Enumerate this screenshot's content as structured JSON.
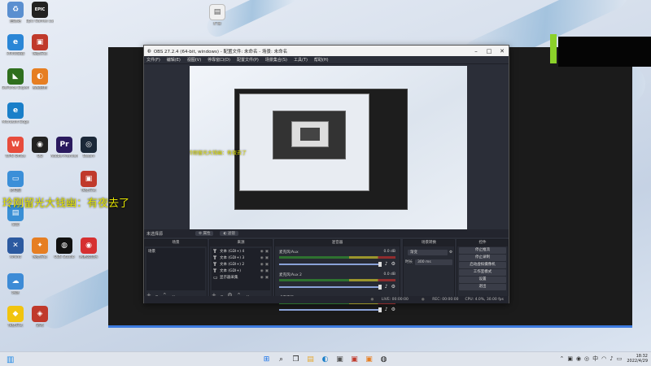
{
  "desktop": {
    "icons": [
      {
        "id": "recycle",
        "label": "回收站",
        "glyph": "♻",
        "color": "#5a8fd0"
      },
      {
        "id": "epic",
        "label": "Epic Games Launcher",
        "glyph": "EPIC",
        "color": "#222222"
      },
      {
        "id": "ie",
        "label": "360浏览器",
        "glyph": "e",
        "color": "#2a86d6"
      },
      {
        "id": "dl",
        "label": "快捷方式",
        "glyph": "▣",
        "color": "#c0392b"
      },
      {
        "id": "geforce",
        "label": "GeForce Experience",
        "glyph": "◣",
        "color": "#2f6f1e"
      },
      {
        "id": "colorapp",
        "label": "系统应用",
        "glyph": "◐",
        "color": "#e67e22"
      },
      {
        "id": "edge",
        "label": "Microsoft Edge",
        "glyph": "e",
        "color": "#1a7fc9"
      },
      {
        "id": "wps",
        "label": "WPS Office",
        "glyph": "W",
        "color": "#e74c3c"
      },
      {
        "id": "qq",
        "label": "QQ",
        "glyph": "◉",
        "color": "#222222"
      },
      {
        "id": "premiere",
        "label": "Adobe Premiere",
        "glyph": "Pr",
        "color": "#2a1a5e"
      },
      {
        "id": "steam",
        "label": "Steam",
        "glyph": "◎",
        "color": "#1b2838"
      },
      {
        "id": "pc",
        "label": "此电脑",
        "glyph": "▭",
        "color": "#3b8fd8"
      },
      {
        "id": "app2",
        "label": "快捷方式",
        "glyph": "▣",
        "color": "#c0392b"
      },
      {
        "id": "desktop",
        "label": "桌面",
        "glyph": "▤",
        "color": "#3a8fd5"
      },
      {
        "id": "xmind",
        "label": "XMind",
        "glyph": "✕",
        "color": "#2c5aa0"
      },
      {
        "id": "fox",
        "label": "快捷方式",
        "glyph": "✦",
        "color": "#e67e22"
      },
      {
        "id": "obs",
        "label": "OBS Studio",
        "glyph": "◍",
        "color": "#111111"
      },
      {
        "id": "netease",
        "label": "网易云音乐",
        "glyph": "◉",
        "color": "#d63031"
      },
      {
        "id": "cloud",
        "label": "网盘",
        "glyph": "☁",
        "color": "#3d8bd6"
      },
      {
        "id": "yellow",
        "label": "快捷方式",
        "glyph": "◆",
        "color": "#f1c40f"
      },
      {
        "id": "game",
        "label": "游戏",
        "glyph": "◈",
        "color": "#c0392b"
      }
    ],
    "overlay_text": "玲刚留光大钱幽：有夜去了",
    "overlay_text_small": "玲刚留光大钱幽：有夜去了"
  },
  "obs": {
    "title": "OBS 27.2.4 (64-bit, windows) - 配置文件: 未命名 - 场景: 未命名",
    "menu": [
      "文件(F)",
      "编辑(E)",
      "视图(V)",
      "停靠窗口(D)",
      "配置文件(P)",
      "场景集合(S)",
      "工具(T)",
      "帮助(H)"
    ],
    "strip_label": "未选择源",
    "strip_buttons": [
      "属性",
      "滤镜"
    ],
    "docks": {
      "scenes": {
        "title": "场景",
        "items": [
          "场景"
        ]
      },
      "sources": {
        "title": "来源",
        "items": [
          {
            "type": "T",
            "name": "文本 (GDI+) 4"
          },
          {
            "type": "T",
            "name": "文本 (GDI+) 3"
          },
          {
            "type": "T",
            "name": "文本 (GDI+) 2"
          },
          {
            "type": "T",
            "name": "文本 (GDI+)"
          },
          {
            "type": "▭",
            "name": "显示器采集"
          }
        ]
      },
      "mixer": {
        "title": "混音器",
        "channels": [
          {
            "name": "麦克风/Aux",
            "value": "0.0 dB"
          },
          {
            "name": "麦克风/Aux 2",
            "value": "0.0 dB"
          },
          {
            "name": "桌面音频",
            "value": ""
          }
        ]
      },
      "transitions": {
        "title": "场景转换",
        "mode": "渐变",
        "duration_label": "时长",
        "duration": "300 ms"
      },
      "controls": {
        "title": "控件",
        "buttons": [
          "停止推流",
          "停止录制",
          "启动虚拟摄像机",
          "工作室模式",
          "设置",
          "退出"
        ]
      }
    },
    "status": {
      "live": "LIVE: 00:00:00",
      "rec": "REC: 00:00:00",
      "cpu": "CPU: 4.0%, 30.00 fps"
    }
  },
  "taskbar": {
    "time": "18:32",
    "date": "2022/4/29"
  }
}
